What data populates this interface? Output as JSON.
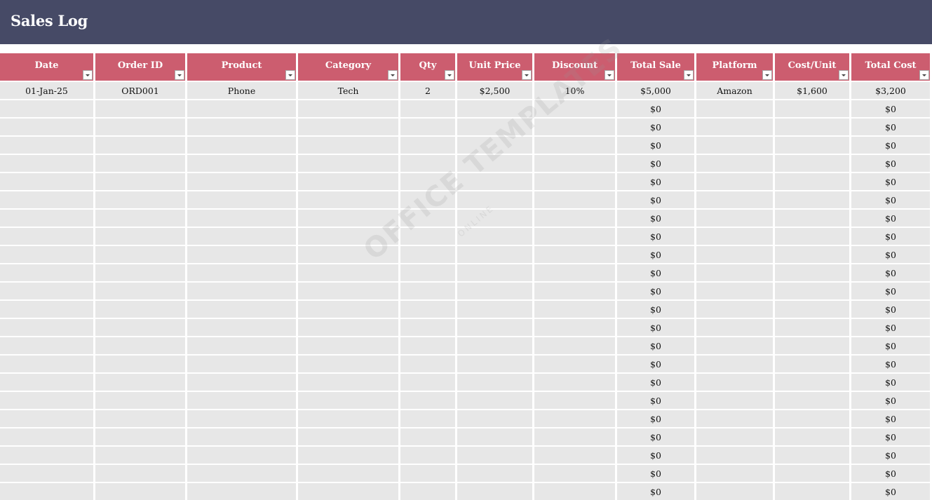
{
  "title": "Sales Log",
  "columns": [
    "Date",
    "Order ID",
    "Product",
    "Category",
    "Qty",
    "Unit Price",
    "Discount",
    "Total Sale",
    "Platform",
    "Cost/Unit",
    "Total Cost"
  ],
  "rows": [
    [
      "01-Jan-25",
      "ORD001",
      "Phone",
      "Tech",
      "2",
      "$2,500",
      "10%",
      "$5,000",
      "Amazon",
      "$1,600",
      "$3,200"
    ],
    [
      "",
      "",
      "",
      "",
      "",
      "",
      "",
      "$0",
      "",
      "",
      "$0"
    ],
    [
      "",
      "",
      "",
      "",
      "",
      "",
      "",
      "$0",
      "",
      "",
      "$0"
    ],
    [
      "",
      "",
      "",
      "",
      "",
      "",
      "",
      "$0",
      "",
      "",
      "$0"
    ],
    [
      "",
      "",
      "",
      "",
      "",
      "",
      "",
      "$0",
      "",
      "",
      "$0"
    ],
    [
      "",
      "",
      "",
      "",
      "",
      "",
      "",
      "$0",
      "",
      "",
      "$0"
    ],
    [
      "",
      "",
      "",
      "",
      "",
      "",
      "",
      "$0",
      "",
      "",
      "$0"
    ],
    [
      "",
      "",
      "",
      "",
      "",
      "",
      "",
      "$0",
      "",
      "",
      "$0"
    ],
    [
      "",
      "",
      "",
      "",
      "",
      "",
      "",
      "$0",
      "",
      "",
      "$0"
    ],
    [
      "",
      "",
      "",
      "",
      "",
      "",
      "",
      "$0",
      "",
      "",
      "$0"
    ],
    [
      "",
      "",
      "",
      "",
      "",
      "",
      "",
      "$0",
      "",
      "",
      "$0"
    ],
    [
      "",
      "",
      "",
      "",
      "",
      "",
      "",
      "$0",
      "",
      "",
      "$0"
    ],
    [
      "",
      "",
      "",
      "",
      "",
      "",
      "",
      "$0",
      "",
      "",
      "$0"
    ],
    [
      "",
      "",
      "",
      "",
      "",
      "",
      "",
      "$0",
      "",
      "",
      "$0"
    ],
    [
      "",
      "",
      "",
      "",
      "",
      "",
      "",
      "$0",
      "",
      "",
      "$0"
    ],
    [
      "",
      "",
      "",
      "",
      "",
      "",
      "",
      "$0",
      "",
      "",
      "$0"
    ],
    [
      "",
      "",
      "",
      "",
      "",
      "",
      "",
      "$0",
      "",
      "",
      "$0"
    ],
    [
      "",
      "",
      "",
      "",
      "",
      "",
      "",
      "$0",
      "",
      "",
      "$0"
    ],
    [
      "",
      "",
      "",
      "",
      "",
      "",
      "",
      "$0",
      "",
      "",
      "$0"
    ],
    [
      "",
      "",
      "",
      "",
      "",
      "",
      "",
      "$0",
      "",
      "",
      "$0"
    ],
    [
      "",
      "",
      "",
      "",
      "",
      "",
      "",
      "$0",
      "",
      "",
      "$0"
    ],
    [
      "",
      "",
      "",
      "",
      "",
      "",
      "",
      "$0",
      "",
      "",
      "$0"
    ],
    [
      "",
      "",
      "",
      "",
      "",
      "",
      "",
      "$0",
      "",
      "",
      "$0"
    ]
  ],
  "watermark": {
    "main": "OFFICE TEMPLATES",
    "sub": "ONLINE"
  },
  "colors": {
    "title_bar": "#464a66",
    "header": "#cc5d6f",
    "cell": "#e7e7e7"
  },
  "icons": {
    "filter": "filter-dropdown-icon"
  }
}
